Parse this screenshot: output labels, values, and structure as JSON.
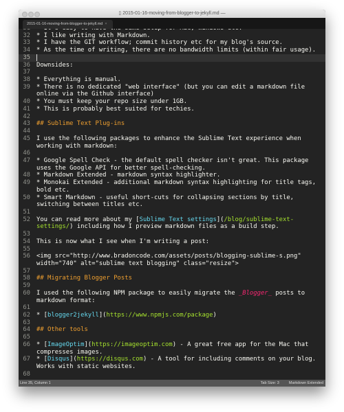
{
  "window": {
    "title": "2015-01-16-moving-from-blogger-to-jekyll.md —",
    "tab": "2015-01-16-moving-from-blogger-to-jekyll.md",
    "tab_close": "×"
  },
  "editor": {
    "current_line": "35",
    "lines": [
      {
        "n": "31",
        "rows": [
          [
            {
              "t": "* It's easy to have the same setup for Mac, Windows etc."
            }
          ]
        ]
      },
      {
        "n": "32",
        "rows": [
          [
            {
              "t": "* I like writing with Markdown."
            }
          ]
        ]
      },
      {
        "n": "33",
        "rows": [
          [
            {
              "t": "* I have the GIT workflow; commit history etc for my blog's source."
            }
          ]
        ]
      },
      {
        "n": "34",
        "rows": [
          [
            {
              "t": "* As the time of writing, there are no bandwidth limits (within fair usage)."
            }
          ]
        ]
      },
      {
        "n": "35",
        "rows": [
          []
        ]
      },
      {
        "n": "36",
        "rows": [
          [
            {
              "t": "Downsides:"
            }
          ]
        ]
      },
      {
        "n": "37",
        "rows": [
          []
        ]
      },
      {
        "n": "38",
        "rows": [
          [
            {
              "t": "* Everything is manual."
            }
          ]
        ]
      },
      {
        "n": "39",
        "rows": [
          [
            {
              "t": "* There is no dedicated \"web interface\" (but you can edit a markdown file"
            }
          ],
          [
            {
              "t": "online via the Github interface)"
            }
          ]
        ]
      },
      {
        "n": "40",
        "rows": [
          [
            {
              "t": "* You must keep your repo size under 1GB."
            }
          ]
        ]
      },
      {
        "n": "41",
        "rows": [
          [
            {
              "t": "* This is probably best suited for techies."
            }
          ]
        ]
      },
      {
        "n": "42",
        "rows": [
          []
        ]
      },
      {
        "n": "43",
        "rows": [
          [
            {
              "t": "## Sublime Text Plug-ins",
              "k": "h"
            }
          ]
        ]
      },
      {
        "n": "44",
        "rows": [
          []
        ]
      },
      {
        "n": "45",
        "rows": [
          [
            {
              "t": "I use the following packages to enhance the Sublime Text experience when"
            }
          ],
          [
            {
              "t": "working with markdown:"
            }
          ]
        ]
      },
      {
        "n": "46",
        "rows": [
          []
        ]
      },
      {
        "n": "47",
        "rows": [
          [
            {
              "t": "* Google Spell Check - the default spell checker isn't great. This package"
            }
          ],
          [
            {
              "t": "uses the Google API for better spell-checking."
            }
          ]
        ]
      },
      {
        "n": "48",
        "rows": [
          [
            {
              "t": "* Markdown Extended - markdown syntax highlighter."
            }
          ]
        ]
      },
      {
        "n": "49",
        "rows": [
          [
            {
              "t": "* Monokai Extended - additional markdown syntax highlighting for title tags,"
            }
          ],
          [
            {
              "t": "bold etc."
            }
          ]
        ]
      },
      {
        "n": "50",
        "rows": [
          [
            {
              "t": "* Smart Markdown - useful short-cuts for collapsing sections by title,"
            }
          ],
          [
            {
              "t": "switching between titles etc."
            }
          ]
        ]
      },
      {
        "n": "51",
        "rows": [
          []
        ]
      },
      {
        "n": "52",
        "rows": [
          [
            {
              "t": "You can read more about my ["
            },
            {
              "t": "Sublime Text settings",
              "k": "lt"
            },
            {
              "t": "]("
            },
            {
              "t": "/blog/sublime-text-",
              "k": "url"
            }
          ],
          [
            {
              "t": "settings/",
              "k": "url"
            },
            {
              "t": ") including how I preview markdown files as a build step."
            }
          ]
        ]
      },
      {
        "n": "53",
        "rows": [
          []
        ]
      },
      {
        "n": "54",
        "rows": [
          [
            {
              "t": "This is now what I see when I'm writing a post:"
            }
          ]
        ]
      },
      {
        "n": "55",
        "rows": [
          []
        ]
      },
      {
        "n": "56",
        "rows": [
          [
            {
              "t": "<img src=\"http://www.bradoncode.com/assets/posts/blogging-sublime-s.png\""
            }
          ],
          [
            {
              "t": "width=\"740\" alt=\"sublime text blogging\" class=\"resize\">"
            }
          ]
        ]
      },
      {
        "n": "57",
        "rows": [
          []
        ]
      },
      {
        "n": "58",
        "rows": [
          [
            {
              "t": "## Migrating Blogger Posts",
              "k": "h"
            }
          ]
        ]
      },
      {
        "n": "59",
        "rows": [
          []
        ]
      },
      {
        "n": "60",
        "rows": [
          [
            {
              "t": "I used the following NPM package to easily migrate the "
            },
            {
              "t": "_Blogger_",
              "k": "it"
            },
            {
              "t": " posts to"
            }
          ],
          [
            {
              "t": "markdown format:"
            }
          ]
        ]
      },
      {
        "n": "61",
        "rows": [
          []
        ]
      },
      {
        "n": "62",
        "rows": [
          [
            {
              "t": "* ["
            },
            {
              "t": "blogger2jekyll",
              "k": "lt"
            },
            {
              "t": "]("
            },
            {
              "t": "https://www.npmjs.com/package",
              "k": "url"
            },
            {
              "t": ")"
            }
          ]
        ]
      },
      {
        "n": "63",
        "rows": [
          []
        ]
      },
      {
        "n": "64",
        "rows": [
          [
            {
              "t": "## Other tools",
              "k": "h"
            }
          ]
        ]
      },
      {
        "n": "65",
        "rows": [
          []
        ]
      },
      {
        "n": "66",
        "rows": [
          [
            {
              "t": "* ["
            },
            {
              "t": "ImageOptim",
              "k": "lt"
            },
            {
              "t": "]("
            },
            {
              "t": "https://imageoptim.com",
              "k": "url"
            },
            {
              "t": ") - A great free app for the Mac that"
            }
          ],
          [
            {
              "t": "compresses images."
            }
          ]
        ]
      },
      {
        "n": "67",
        "rows": [
          [
            {
              "t": "* ["
            },
            {
              "t": "Disqus",
              "k": "lt"
            },
            {
              "t": "]("
            },
            {
              "t": "https://disqus.com",
              "k": "url"
            },
            {
              "t": ") - A tool for including comments on your blog."
            }
          ],
          [
            {
              "t": "Works with static websites."
            }
          ]
        ]
      },
      {
        "n": "68",
        "rows": [
          []
        ]
      }
    ]
  },
  "status": {
    "position": "Line 35, Column 1",
    "tab_size": "Tab Size: 3",
    "syntax": "Markdown Extended"
  },
  "colors": {
    "background": "#232323",
    "heading": "#f0a030",
    "link_text": "#66d9ef",
    "url": "#a6e22e",
    "italic": "#f92672"
  }
}
